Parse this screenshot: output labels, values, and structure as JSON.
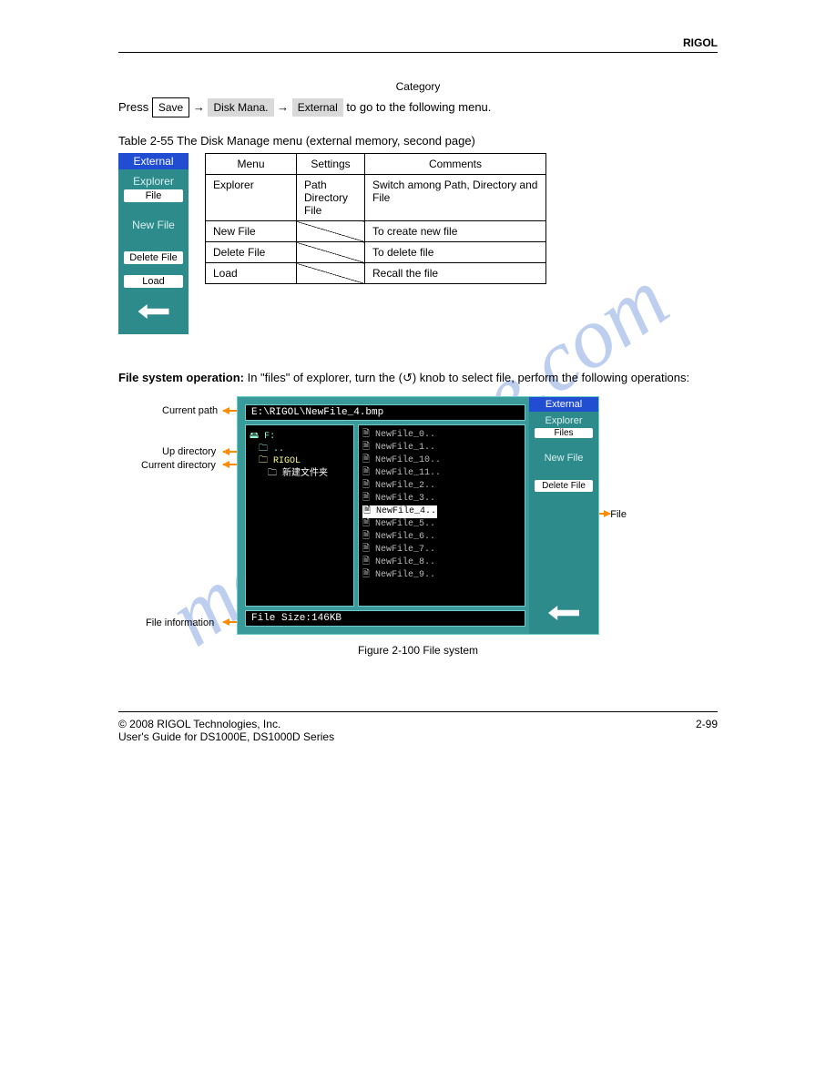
{
  "header": {
    "brand": "RIGOL",
    "category": "Category"
  },
  "intro": {
    "prefix": "Press",
    "btn_save": "Save",
    "arrow": "→",
    "btn_disk": "Disk Mana.",
    "arrow2": "→",
    "btn_external": "External",
    "suffix": " to go to the following menu."
  },
  "table": {
    "caption": "Table 2-55 The Disk Manage menu (external memory, second page)",
    "headers": [
      "Menu",
      "Settings",
      "Comments"
    ],
    "rows": [
      {
        "menu": "Explorer",
        "settings": [
          "Path",
          "Directory",
          "File"
        ],
        "comment": "Switch among Path, Directory and File"
      },
      {
        "menu": "New File",
        "settings": null,
        "comment": "To create new file"
      },
      {
        "menu": "Delete File",
        "settings": null,
        "comment": "To delete file"
      },
      {
        "menu": "Load",
        "settings": null,
        "comment": "Recall the file"
      }
    ]
  },
  "menu_panel": {
    "header": "External",
    "items": [
      {
        "label": "Explorer",
        "sub": "File"
      },
      {
        "label": "New File"
      },
      {
        "label": "Delete File",
        "sub_style": "white"
      },
      {
        "label": "Load",
        "sub_style": "white"
      }
    ]
  },
  "subsection": {
    "bold": "File system operation:",
    "text": " In \"files\" of explorer, turn the (↺) knob to select file, perform the following operations:"
  },
  "screenshot": {
    "path": "E:\\RIGOL\\NewFile_4.bmp",
    "dirs": {
      "root": "🖴 F:",
      "up": "🗀 ..",
      "folder1": "🗀 RIGOL",
      "folder2": "🗀 新建文件夹"
    },
    "files": [
      "NewFile_0..",
      "NewFile_1..",
      "NewFile_10..",
      "NewFile_11..",
      "NewFile_2..",
      "NewFile_3..",
      "NewFile_4..",
      "NewFile_5..",
      "NewFile_6..",
      "NewFile_7..",
      "NewFile_8..",
      "NewFile_9.."
    ],
    "selected_index": 6,
    "status": "File Size:146KB",
    "menu": {
      "header": "External",
      "explorer": "Explorer",
      "explorer_sub": "Files",
      "newfile": "New File",
      "deletefile": "Delete File"
    }
  },
  "annotations": {
    "current_path": "Current path",
    "up_dir": "Up directory",
    "current_dir": "Current directory",
    "file_info": "File information",
    "file": "File"
  },
  "figcaption": "Figure 2-100 File system",
  "footer": {
    "left": "© 2008 RIGOL Technologies, Inc.",
    "right": "2-99",
    "sub": "User's Guide for DS1000E, DS1000D Series"
  },
  "watermark": "manualslive.com"
}
